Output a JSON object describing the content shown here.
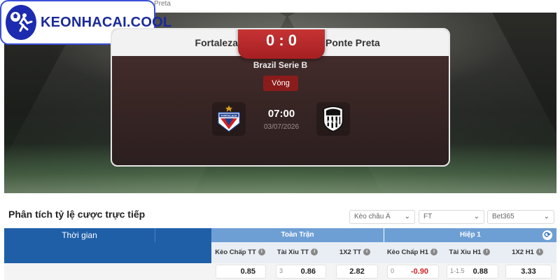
{
  "breadcrumb": {
    "tail": "Preta"
  },
  "brand": {
    "logo_text": "KEONHACAI.COOL",
    "accent": "#1a2a9a"
  },
  "match": {
    "home": "Fortaleza",
    "away": "Ponte Preta",
    "score": "0 : 0",
    "league": "Brazil Serie B",
    "round_label": "Vòng",
    "kickoff_time": "07:00",
    "kickoff_date": "03/07/2026",
    "home_crest_text": "FORTALEZA",
    "away_crest_text": "A.A.P.P"
  },
  "odds_panel": {
    "title": "Phân tích tỷ lệ cược trực tiếp",
    "selects": [
      {
        "value": "Kèo châu Á"
      },
      {
        "value": "FT"
      },
      {
        "value": "Bet365"
      }
    ],
    "header": {
      "time": "Thời gian",
      "full_match": "Toàn Trận",
      "half1": "Hiệp 1"
    },
    "columns": [
      {
        "label": "Kèo Chấp TT"
      },
      {
        "label": "Tài Xỉu TT"
      },
      {
        "label": "1X2 TT"
      },
      {
        "label": "Kèo Chấp H1"
      },
      {
        "label": "Tài Xỉu H1"
      },
      {
        "label": "1X2 H1"
      }
    ],
    "row1": {
      "keo_chap_tt": {
        "line": "",
        "odd": "0.85"
      },
      "tai_xiu_tt": {
        "line": "3",
        "odd": "0.86"
      },
      "x12_tt": {
        "line": "",
        "odd": "2.82"
      },
      "keo_chap_h1": {
        "line": "0",
        "odd": "-0.90"
      },
      "tai_xiu_h1": {
        "line": "1-1.5",
        "odd": "0.88"
      },
      "x12_h1": {
        "line": "",
        "odd": "3.33"
      }
    }
  },
  "colors": {
    "header_blue": "#1f5fa8",
    "header_light_blue": "#6e9fd4",
    "score_red": "#c42e2e",
    "negative_odd": "#d42020"
  }
}
